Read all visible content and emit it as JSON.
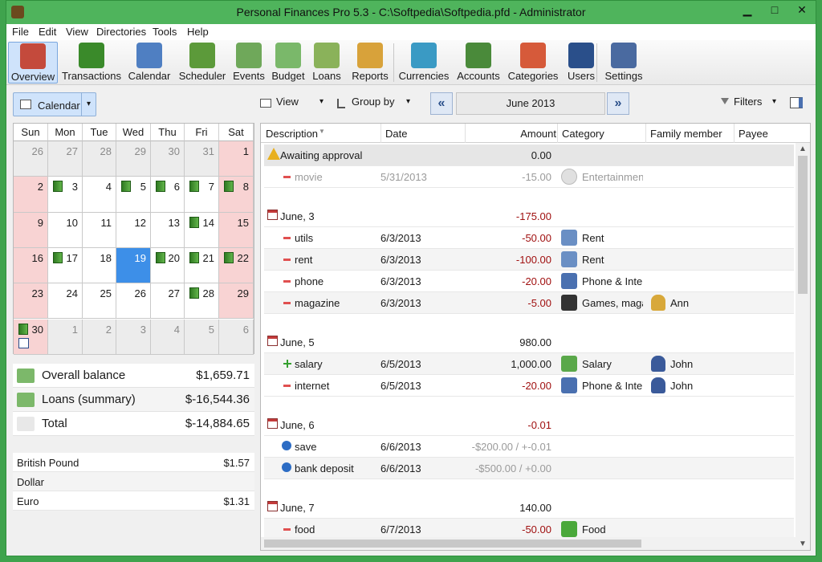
{
  "window": {
    "title": "Personal Finances Pro 5.3 - C:\\Softpedia\\Softpedia.pfd - Administrator",
    "min_glyph": "▁",
    "max_glyph": "□",
    "close_glyph": "✕"
  },
  "menu": [
    "File",
    "Edit",
    "View",
    "Directories",
    "Tools",
    "Help"
  ],
  "toolbar": [
    {
      "label": "Overview",
      "icon": "overview-icon",
      "color": "#c44a3c",
      "active": true
    },
    {
      "label": "Transactions",
      "icon": "transactions-icon",
      "color": "#3a8a2a"
    },
    {
      "label": "Calendar",
      "icon": "calendar-icon",
      "color": "#4f7fc2"
    },
    {
      "label": "Scheduler",
      "icon": "scheduler-icon",
      "color": "#5c9a3a"
    },
    {
      "label": "Events",
      "icon": "events-icon",
      "color": "#6fa85a"
    },
    {
      "label": "Budget",
      "icon": "budget-icon",
      "color": "#7ab86a"
    },
    {
      "label": "Loans",
      "icon": "loans-icon",
      "color": "#8ab25a"
    },
    {
      "label": "Reports",
      "icon": "reports-icon",
      "color": "#d8a23a"
    },
    {
      "label": "Currencies",
      "icon": "currencies-icon",
      "color": "#3a9ac4"
    },
    {
      "label": "Accounts",
      "icon": "accounts-icon",
      "color": "#4a8a3a"
    },
    {
      "label": "Categories",
      "icon": "categories-icon",
      "color": "#d65a3a"
    },
    {
      "label": "Users",
      "icon": "users-icon",
      "color": "#2a4f8a"
    },
    {
      "label": "Settings",
      "icon": "settings-icon",
      "color": "#4a6aa0"
    }
  ],
  "left_toolbar": {
    "label": "Calendar",
    "drop": "▾"
  },
  "calendar": {
    "days": [
      "Sun",
      "Mon",
      "Tue",
      "Wed",
      "Thu",
      "Fri",
      "Sat"
    ],
    "weeks": [
      [
        "26",
        "27",
        "28",
        "29",
        "30",
        "31",
        "1"
      ],
      [
        "2",
        "3",
        "4",
        "5",
        "6",
        "7",
        "8"
      ],
      [
        "9",
        "10",
        "11",
        "12",
        "13",
        "14",
        "15"
      ],
      [
        "16",
        "17",
        "18",
        "19",
        "20",
        "21",
        "22"
      ],
      [
        "23",
        "24",
        "25",
        "26",
        "27",
        "28",
        "29"
      ],
      [
        "30",
        "1",
        "2",
        "3",
        "4",
        "5",
        "6"
      ]
    ]
  },
  "balances": [
    {
      "label": "Overall balance",
      "value": "$1,659.71",
      "icon": "balance-icon"
    },
    {
      "label": "Loans (summary)",
      "value": "$-16,544.36",
      "icon": "loans-summary-icon"
    },
    {
      "label": "Total",
      "value": "$-14,884.65",
      "icon": "scales-icon"
    }
  ],
  "currencies": [
    {
      "label": "British Pound",
      "value": "$1.57"
    },
    {
      "label": "Dollar",
      "value": ""
    },
    {
      "label": "Euro",
      "value": "$1.31"
    }
  ],
  "right_toolbar": {
    "view_label": "View",
    "groupby_label": "Group by",
    "prev_glyph": "«",
    "next_glyph": "»",
    "period": "June 2013",
    "filters_label": "Filters",
    "drop": "▾"
  },
  "list": {
    "columns": [
      "Description",
      "Date",
      "Amount",
      "Category",
      "Family member",
      "Payee"
    ],
    "rows": [
      {
        "kind": "pending",
        "description": "Awaiting approval",
        "amount": "0.00"
      },
      {
        "kind": "minus",
        "description": "movie",
        "date": "5/31/2013",
        "amount": "-15.00",
        "category": "Entertainmen",
        "faded": true
      },
      {
        "kind": "group",
        "description": "June, 3",
        "amount": "-175.00"
      },
      {
        "kind": "minus",
        "description": "utils",
        "date": "6/3/2013",
        "amount": "-50.00",
        "category": "Rent",
        "cat_icon": "building-icon",
        "cat_color": "#6a8fc4"
      },
      {
        "kind": "minus",
        "description": "rent",
        "date": "6/3/2013",
        "amount": "-100.00",
        "category": "Rent",
        "cat_icon": "building-icon",
        "cat_color": "#6a8fc4"
      },
      {
        "kind": "minus",
        "description": "phone",
        "date": "6/3/2013",
        "amount": "-20.00",
        "category": "Phone & Inte",
        "cat_icon": "phone-icon",
        "cat_color": "#4a70b0"
      },
      {
        "kind": "minus",
        "description": "magazine",
        "date": "6/3/2013",
        "amount": "-5.00",
        "category": "Games, maga",
        "cat_icon": "game-icon",
        "cat_color": "#333333",
        "member": "Ann",
        "member_color": "#d8a83a"
      },
      {
        "kind": "group",
        "description": "June, 5",
        "amount": "980.00"
      },
      {
        "kind": "plus",
        "description": "salary",
        "date": "6/5/2013",
        "amount": "1,000.00",
        "category": "Salary",
        "cat_icon": "money-icon",
        "cat_color": "#5aa84a",
        "member": "John",
        "member_color": "#3a5a9a"
      },
      {
        "kind": "minus",
        "description": "internet",
        "date": "6/5/2013",
        "amount": "-20.00",
        "category": "Phone & Inte",
        "cat_icon": "phone-icon",
        "cat_color": "#4a70b0",
        "member": "John",
        "member_color": "#3a5a9a"
      },
      {
        "kind": "group",
        "description": "June, 6",
        "amount": "-0.01"
      },
      {
        "kind": "xfer",
        "description": "save",
        "date": "6/6/2013",
        "amount": "-$200.00 / +-0.01"
      },
      {
        "kind": "xfer",
        "description": "bank deposit",
        "date": "6/6/2013",
        "amount": "-$500.00 / +0.00"
      },
      {
        "kind": "group",
        "description": "June, 7",
        "amount": "140.00"
      },
      {
        "kind": "minus",
        "description": "food",
        "date": "6/7/2013",
        "amount": "-50.00",
        "category": "Food",
        "cat_icon": "apple-icon",
        "cat_color": "#4aa83a"
      }
    ]
  }
}
